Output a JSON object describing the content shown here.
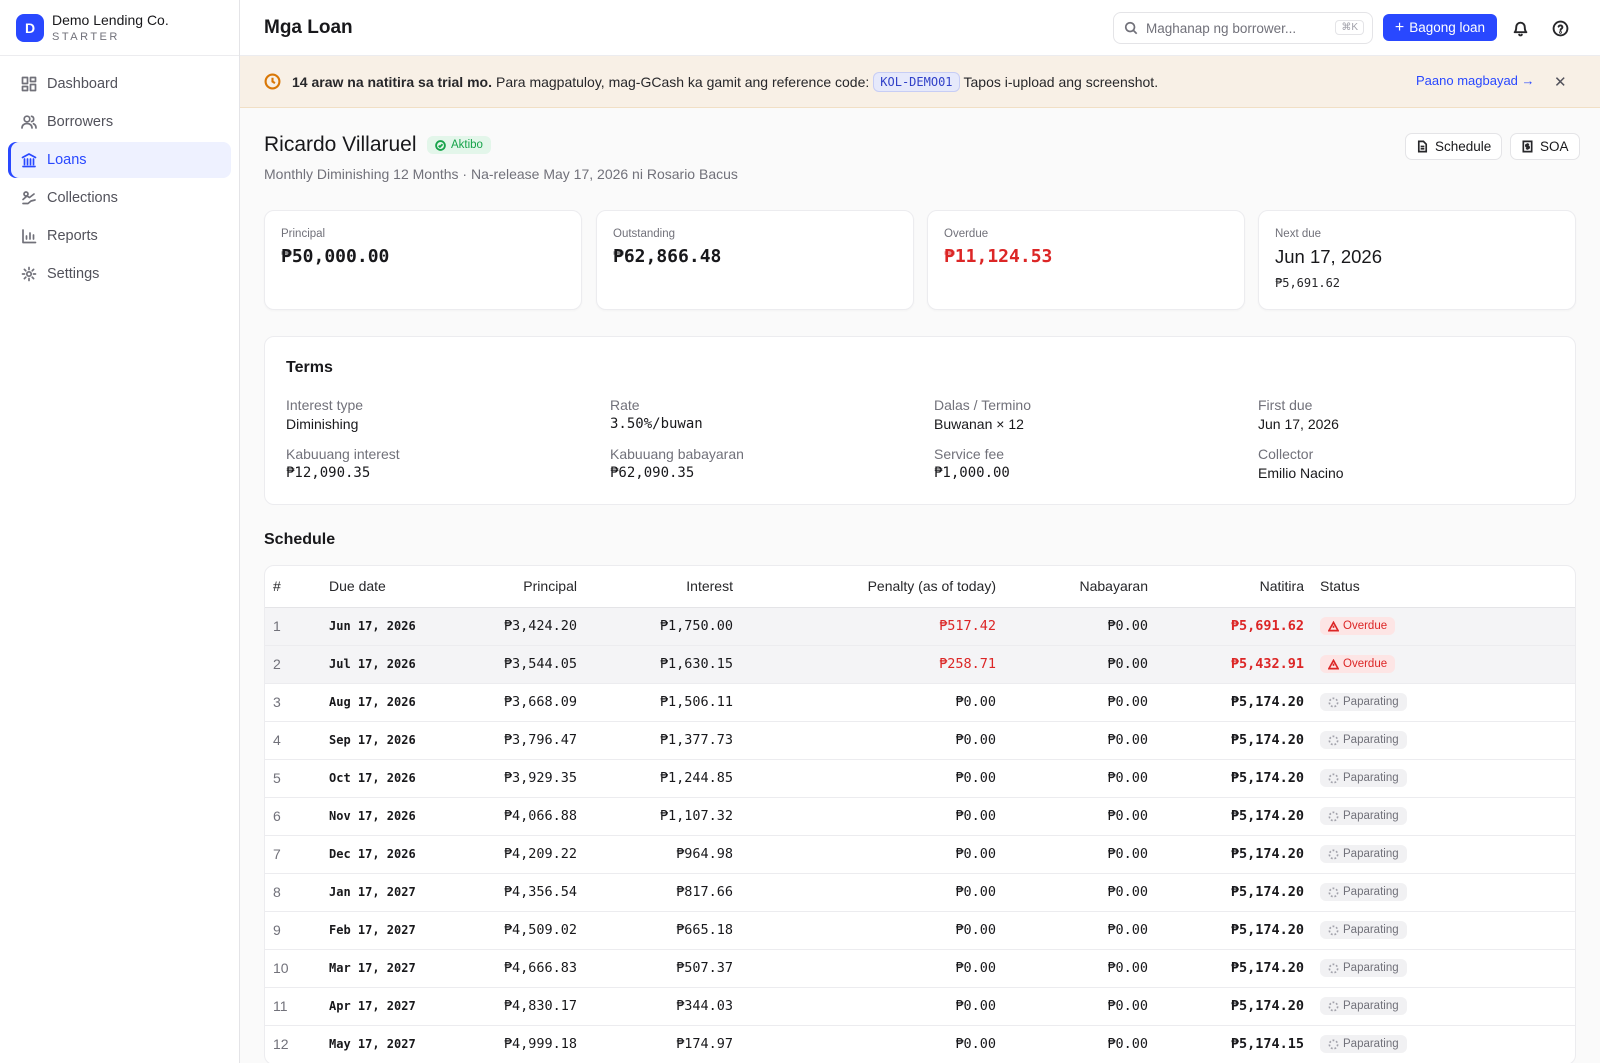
{
  "brand": {
    "initial": "D",
    "name": "Demo Lending Co.",
    "plan": "STARTER"
  },
  "nav": [
    {
      "label": "Dashboard",
      "icon": "dashboard-icon"
    },
    {
      "label": "Borrowers",
      "icon": "users-icon"
    },
    {
      "label": "Loans",
      "icon": "bank-icon",
      "active": true
    },
    {
      "label": "Collections",
      "icon": "collections-icon"
    },
    {
      "label": "Reports",
      "icon": "chart-icon"
    },
    {
      "label": "Settings",
      "icon": "gear-icon"
    }
  ],
  "topbar": {
    "title": "Mga Loan",
    "search_placeholder": "Maghanap ng borrower...",
    "search_shortcut": "⌘K",
    "new_loan_label": "Bagong loan"
  },
  "banner": {
    "bold_text": "14 araw na natitira sa trial mo.",
    "text_before_code": "Para magpatuloy, mag-GCash ka gamit ang reference code:",
    "code": "KOL-DEMO01",
    "text_after_code": "Tapos i-upload ang screenshot.",
    "link_label": "Paano magbayad →",
    "close_label": "✕"
  },
  "loan": {
    "borrower": "Ricardo Villaruel",
    "status": "Aktibo",
    "subtitle": "Monthly Diminishing 12 Months · Na-release May 17, 2026 ni Rosario Bacus",
    "schedule_btn": "Schedule",
    "soa_btn": "SOA"
  },
  "stats": {
    "principal": {
      "label": "Principal",
      "value": "₱50,000.00"
    },
    "outstanding": {
      "label": "Outstanding",
      "value": "₱62,866.48"
    },
    "overdue": {
      "label": "Overdue",
      "value": "₱11,124.53"
    },
    "next_due": {
      "label": "Next due",
      "value": "Jun 17, 2026",
      "amount": "₱5,691.62"
    }
  },
  "terms": {
    "title": "Terms",
    "interest_type": {
      "label": "Interest type",
      "value": "Diminishing"
    },
    "rate": {
      "label": "Rate",
      "value": "3.50%/buwan"
    },
    "term": {
      "label": "Dalas / Termino",
      "value": "Buwanan × 12"
    },
    "first_due": {
      "label": "First due",
      "value": "Jun 17, 2026"
    },
    "total_interest": {
      "label": "Kabuuang interest",
      "value": "₱12,090.35"
    },
    "total_payment": {
      "label": "Kabuuang babayaran",
      "value": "₱62,090.35"
    },
    "service_fee": {
      "label": "Service fee",
      "value": "₱1,000.00"
    },
    "collector": {
      "label": "Collector",
      "value": "Emilio Nacino"
    }
  },
  "schedule": {
    "title": "Schedule",
    "columns": [
      "#",
      "Due date",
      "Principal",
      "Interest",
      "Penalty (as of today)",
      "Nabayaran",
      "Natitira",
      "Status"
    ],
    "rows": [
      {
        "n": "1",
        "due": "Jun 17, 2026",
        "principal": "₱3,424.20",
        "interest": "₱1,750.00",
        "penalty": "₱517.42",
        "paid": "₱0.00",
        "balance": "₱5,691.62",
        "status": "Overdue",
        "overdue": true
      },
      {
        "n": "2",
        "due": "Jul 17, 2026",
        "principal": "₱3,544.05",
        "interest": "₱1,630.15",
        "penalty": "₱258.71",
        "paid": "₱0.00",
        "balance": "₱5,432.91",
        "status": "Overdue",
        "overdue": true
      },
      {
        "n": "3",
        "due": "Aug 17, 2026",
        "principal": "₱3,668.09",
        "interest": "₱1,506.11",
        "penalty": "₱0.00",
        "paid": "₱0.00",
        "balance": "₱5,174.20",
        "status": "Paparating",
        "overdue": false
      },
      {
        "n": "4",
        "due": "Sep 17, 2026",
        "principal": "₱3,796.47",
        "interest": "₱1,377.73",
        "penalty": "₱0.00",
        "paid": "₱0.00",
        "balance": "₱5,174.20",
        "status": "Paparating",
        "overdue": false
      },
      {
        "n": "5",
        "due": "Oct 17, 2026",
        "principal": "₱3,929.35",
        "interest": "₱1,244.85",
        "penalty": "₱0.00",
        "paid": "₱0.00",
        "balance": "₱5,174.20",
        "status": "Paparating",
        "overdue": false
      },
      {
        "n": "6",
        "due": "Nov 17, 2026",
        "principal": "₱4,066.88",
        "interest": "₱1,107.32",
        "penalty": "₱0.00",
        "paid": "₱0.00",
        "balance": "₱5,174.20",
        "status": "Paparating",
        "overdue": false
      },
      {
        "n": "7",
        "due": "Dec 17, 2026",
        "principal": "₱4,209.22",
        "interest": "₱964.98",
        "penalty": "₱0.00",
        "paid": "₱0.00",
        "balance": "₱5,174.20",
        "status": "Paparating",
        "overdue": false
      },
      {
        "n": "8",
        "due": "Jan 17, 2027",
        "principal": "₱4,356.54",
        "interest": "₱817.66",
        "penalty": "₱0.00",
        "paid": "₱0.00",
        "balance": "₱5,174.20",
        "status": "Paparating",
        "overdue": false
      },
      {
        "n": "9",
        "due": "Feb 17, 2027",
        "principal": "₱4,509.02",
        "interest": "₱665.18",
        "penalty": "₱0.00",
        "paid": "₱0.00",
        "balance": "₱5,174.20",
        "status": "Paparating",
        "overdue": false
      },
      {
        "n": "10",
        "due": "Mar 17, 2027",
        "principal": "₱4,666.83",
        "interest": "₱507.37",
        "penalty": "₱0.00",
        "paid": "₱0.00",
        "balance": "₱5,174.20",
        "status": "Paparating",
        "overdue": false
      },
      {
        "n": "11",
        "due": "Apr 17, 2027",
        "principal": "₱4,830.17",
        "interest": "₱344.03",
        "penalty": "₱0.00",
        "paid": "₱0.00",
        "balance": "₱5,174.20",
        "status": "Paparating",
        "overdue": false
      },
      {
        "n": "12",
        "due": "May 17, 2027",
        "principal": "₱4,999.18",
        "interest": "₱174.97",
        "penalty": "₱0.00",
        "paid": "₱0.00",
        "balance": "₱5,174.15",
        "status": "Paparating",
        "overdue": false
      }
    ]
  },
  "colors": {
    "accent": "#2948ff",
    "danger": "#dc2626",
    "success": "#16a34a",
    "warning": "#d97706"
  }
}
